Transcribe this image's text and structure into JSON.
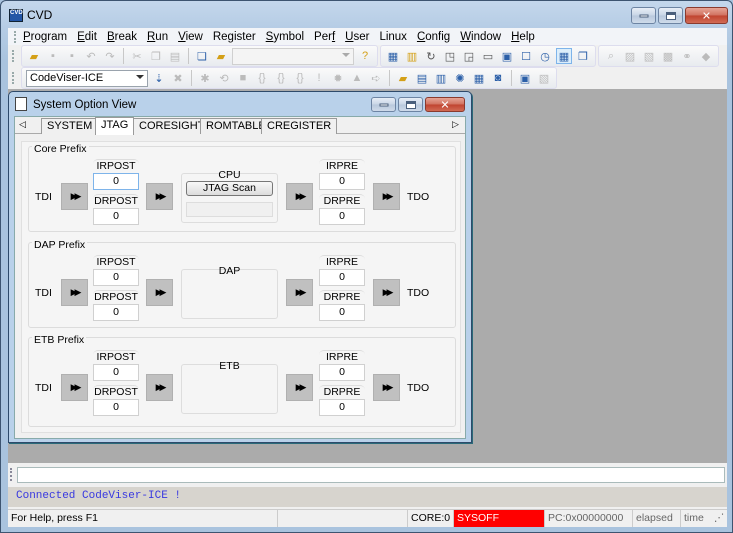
{
  "app": {
    "title": "CVD",
    "icon": "cvd-app-icon"
  },
  "window_controls": {
    "minimize": "minimize",
    "maximize": "maximize",
    "close": "close"
  },
  "menubar": {
    "items": [
      {
        "label": "Program",
        "u": "P"
      },
      {
        "label": "Edit",
        "u": "E"
      },
      {
        "label": "Break",
        "u": "B"
      },
      {
        "label": "Run",
        "u": "R"
      },
      {
        "label": "View",
        "u": "V"
      },
      {
        "label": "Register",
        "u": "g"
      },
      {
        "label": "Symbol",
        "u": "S"
      },
      {
        "label": "Perf",
        "u": "f"
      },
      {
        "label": "User",
        "u": "U"
      },
      {
        "label": "Linux",
        "u": ""
      },
      {
        "label": "Config",
        "u": "C"
      },
      {
        "label": "Window",
        "u": "W"
      },
      {
        "label": "Help",
        "u": "H"
      }
    ]
  },
  "toolbar1": {
    "combo_value": "",
    "icons": [
      "open-folder",
      "save",
      "save-all",
      "undo",
      "redo",
      "cut",
      "copy",
      "paste",
      "windows",
      "open-project",
      "help",
      "memory-view",
      "register-view",
      "refresh",
      "step-into-window",
      "step-out-window",
      "disassembly",
      "watch",
      "window",
      "stopwatch",
      "grid-view",
      "window-cascade",
      "find",
      "image-view",
      "chart-view",
      "compare-view",
      "link",
      "pin"
    ]
  },
  "toolbar2": {
    "target_combo": "CodeViser-ICE",
    "icons": [
      "sort",
      "disconnect",
      "break-point",
      "reset",
      "stop",
      "step-into",
      "step-over",
      "step-out",
      "run-to",
      "run",
      "warning",
      "next",
      "project",
      "script",
      "edit-script",
      "settings",
      "table",
      "record",
      "hex-view",
      "trace"
    ]
  },
  "child_window": {
    "title": "System Option View",
    "tabs": [
      "SYSTEM",
      "JTAG",
      "CORESIGHT",
      "ROMTABLE",
      "CREGISTER"
    ],
    "active_tab": "JTAG",
    "groups": [
      {
        "title": "Core Prefix",
        "center_label": "CPU",
        "button": "JTAG Scan",
        "tdi": "TDI",
        "tdo": "TDO",
        "irpost_label": "IRPOST",
        "irpost": "0",
        "drpost_label": "DRPOST",
        "drpost": "0",
        "irpre_label": "IRPRE",
        "irpre": "0",
        "drpre_label": "DRPRE",
        "drpre": "0"
      },
      {
        "title": "DAP Prefix",
        "center_label": "DAP",
        "tdi": "TDI",
        "tdo": "TDO",
        "irpost_label": "IRPOST",
        "irpost": "0",
        "drpost_label": "DRPOST",
        "drpost": "0",
        "irpre_label": "IRPRE",
        "irpre": "0",
        "drpre_label": "DRPRE",
        "drpre": "0"
      },
      {
        "title": "ETB Prefix",
        "center_label": "ETB",
        "tdi": "TDI",
        "tdo": "TDO",
        "irpost_label": "IRPOST",
        "irpost": "0",
        "drpost_label": "DRPOST",
        "drpost": "0",
        "irpre_label": "IRPRE",
        "irpre": "0",
        "drpre_label": "DRPRE",
        "drpre": "0"
      }
    ]
  },
  "command": {
    "value": ""
  },
  "output": {
    "message": "Connected CodeViser-ICE !"
  },
  "statusbar": {
    "help": "For Help, press F1",
    "core": "CORE:0",
    "state": "SYSOFF",
    "pc": "PC:0x00000000",
    "elapsed": "elapsed",
    "time": "time"
  },
  "colors": {
    "sysoff_bg": "#ff0000",
    "output_text": "#3838e0",
    "mdi_bg": "#ababab"
  }
}
